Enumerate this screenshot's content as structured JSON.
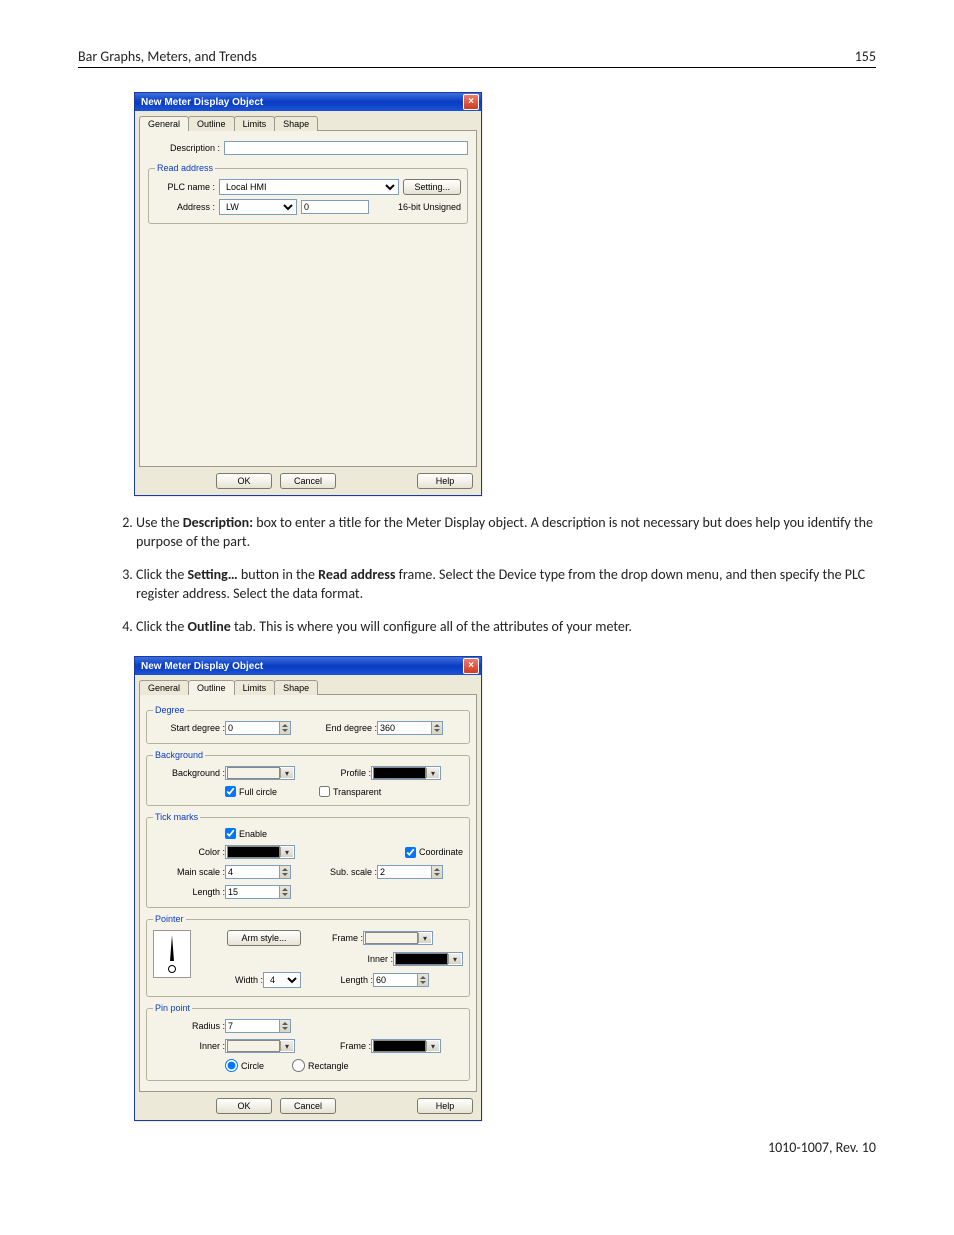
{
  "header": {
    "title": "Bar Graphs, Meters, and Trends",
    "page": "155"
  },
  "footer": {
    "rev": "1010-1007, Rev. 10"
  },
  "dialog1": {
    "title": "New  Meter Display Object",
    "tabs": [
      "General",
      "Outline",
      "Limits",
      "Shape"
    ],
    "labels": {
      "description": "Description :",
      "readaddr_legend": "Read address",
      "plcname": "PLC name :",
      "address": "Address :",
      "setting": "Setting...",
      "dtype": "16-bit Unsigned"
    },
    "values": {
      "description": "",
      "plcname": "Local HMI",
      "address_type": "LW",
      "address_num": "0"
    },
    "buttons": {
      "ok": "OK",
      "cancel": "Cancel",
      "help": "Help"
    }
  },
  "steps": {
    "s2a": "Use the ",
    "s2b": "Description:",
    "s2c": " box to enter a title for the Meter Display object. A description is not necessary but does help you identify the purpose of the part.",
    "s3a": "Click the ",
    "s3b": "Setting…",
    "s3c": " button in the ",
    "s3d": "Read address",
    "s3e": " frame. Select the Device type from the drop down menu, and then specify the PLC register address. Select the data format.",
    "s4a": "Click the ",
    "s4b": "Outline",
    "s4c": " tab. This is where you will configure all of the attributes of your meter."
  },
  "dialog2": {
    "title": "New  Meter Display Object",
    "tabs": [
      "General",
      "Outline",
      "Limits",
      "Shape"
    ],
    "degree": {
      "legend": "Degree",
      "start_lbl": "Start degree :",
      "start": "0",
      "end_lbl": "End degree :",
      "end": "360"
    },
    "background": {
      "legend": "Background",
      "bg_lbl": "Background :",
      "bg_color": "#f5f3e8",
      "profile_lbl": "Profile :",
      "profile_color": "#000000",
      "full_circle": "Full circle",
      "full_circle_checked": true,
      "transparent": "Transparent",
      "transparent_checked": false
    },
    "tick": {
      "legend": "Tick marks",
      "enable": "Enable",
      "enable_checked": true,
      "color_lbl": "Color :",
      "color": "#000000",
      "coordinate": "Coordinate",
      "coordinate_checked": true,
      "main_lbl": "Main scale :",
      "main": "4",
      "sub_lbl": "Sub. scale :",
      "sub": "2",
      "length_lbl": "Length :",
      "length": "15"
    },
    "pointer": {
      "legend": "Pointer",
      "arm": "Arm style...",
      "frame_lbl": "Frame :",
      "frame_color": "#f5f3e8",
      "inner_lbl": "Inner :",
      "inner_color": "#000000",
      "width_lbl": "Width :",
      "width": "4",
      "length_lbl": "Length :",
      "length": "60"
    },
    "pin": {
      "legend": "Pin point",
      "radius_lbl": "Radius :",
      "radius": "7",
      "inner_lbl": "Inner :",
      "inner_color": "#f5f3e8",
      "frame_lbl": "Frame :",
      "frame_color": "#000000",
      "circle": "Circle",
      "rectangle": "Rectangle"
    },
    "buttons": {
      "ok": "OK",
      "cancel": "Cancel",
      "help": "Help"
    }
  }
}
